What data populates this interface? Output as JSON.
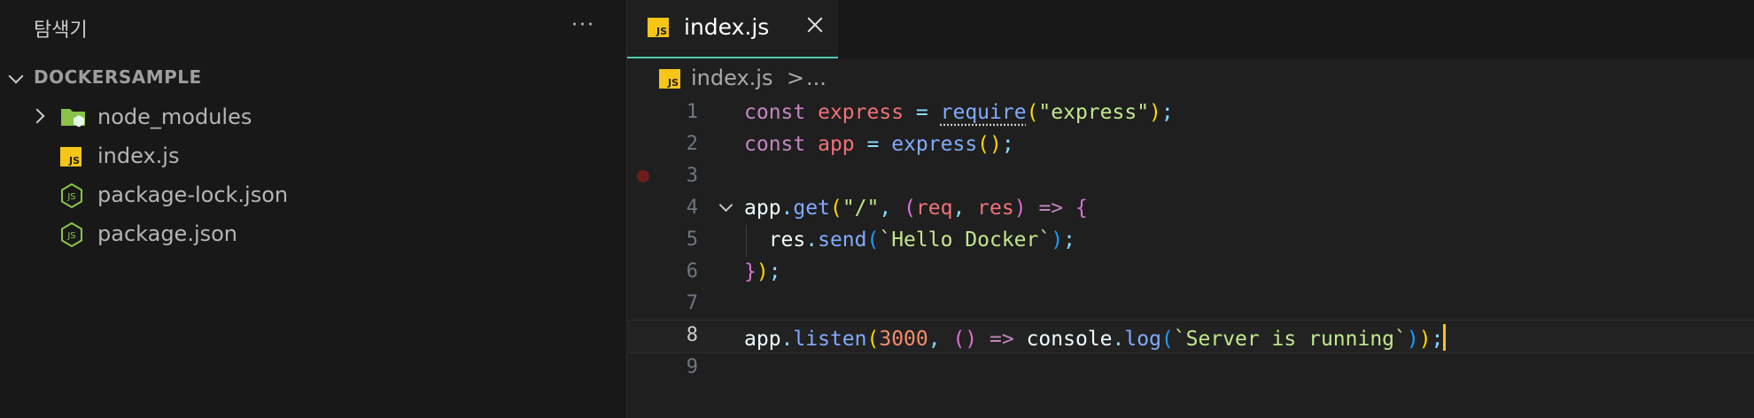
{
  "sidebar": {
    "title": "탐색기",
    "more": "···",
    "section": "DOCKERSAMPLE",
    "items": [
      {
        "label": "node_modules",
        "icon": "folder-node-icon"
      },
      {
        "label": "index.js",
        "icon": "js-file-icon"
      },
      {
        "label": "package-lock.json",
        "icon": "nodejs-file-icon"
      },
      {
        "label": "package.json",
        "icon": "nodejs-file-icon"
      }
    ]
  },
  "editor": {
    "tab": {
      "label": "index.js",
      "icon": "JS"
    },
    "breadcrumb": {
      "file": "index.js",
      "sep": ">",
      "more": "..."
    },
    "lines": [
      {
        "n": "1"
      },
      {
        "n": "2"
      },
      {
        "n": "3"
      },
      {
        "n": "4"
      },
      {
        "n": "5"
      },
      {
        "n": "6"
      },
      {
        "n": "7"
      },
      {
        "n": "8"
      },
      {
        "n": "9"
      }
    ],
    "tokens": {
      "const": "const",
      "express": "express",
      "eq": "=",
      "require": "require",
      "express_str": "\"express\"",
      "app": "app",
      "get": "get",
      "slash_str": "\"/\"",
      "req": "req",
      "res": "res",
      "arrow": "=>",
      "send": "send",
      "hello_str": "`Hello Docker`",
      "listen": "listen",
      "port": "3000",
      "console": "console",
      "log": "log",
      "server_str": "`Server is running`"
    }
  },
  "colors": {
    "accent_tab_border": "#4ec9b0",
    "js_badge": "#f5c518",
    "breakpoint": "#6e1d1d",
    "cursor": "#f5c518"
  }
}
